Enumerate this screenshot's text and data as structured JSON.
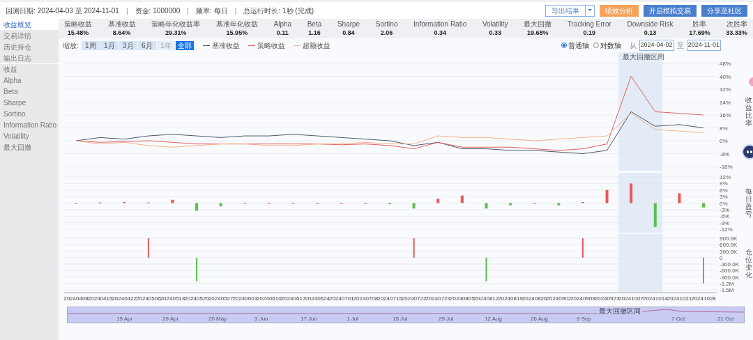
{
  "header": {
    "separator": "|",
    "info": [
      {
        "label": "回测日期:",
        "value": "2024-04-03 至 2024-11-01"
      },
      {
        "label": "资金:",
        "value": "1000000"
      },
      {
        "label": "频率:",
        "value": "每日"
      },
      {
        "label": "总运行时长:",
        "value": "1秒 (完成)"
      }
    ],
    "export_button": "导出结果",
    "buttons": [
      {
        "label": "绩效分析",
        "kind": "orange"
      },
      {
        "label": "开启模拟交易",
        "kind": "blue"
      },
      {
        "label": "分享至社区",
        "kind": "blue"
      }
    ]
  },
  "sidebar": {
    "items": [
      {
        "label": "收益概览",
        "selected": true,
        "kind": "nav"
      },
      {
        "label": "交易详情",
        "selected": false,
        "kind": "nav"
      },
      {
        "label": "历史持仓",
        "selected": false,
        "kind": "nav"
      },
      {
        "label": "输出日志",
        "selected": false,
        "kind": "nav"
      },
      {
        "label": "收益",
        "selected": false,
        "kind": "metric"
      },
      {
        "label": "Alpha",
        "selected": false,
        "kind": "metric"
      },
      {
        "label": "Beta",
        "selected": false,
        "kind": "metric"
      },
      {
        "label": "Sharpe",
        "selected": false,
        "kind": "metric"
      },
      {
        "label": "Sortino",
        "selected": false,
        "kind": "metric"
      },
      {
        "label": "Information Ratio",
        "selected": false,
        "kind": "metric"
      },
      {
        "label": "Volatility",
        "selected": false,
        "kind": "metric"
      },
      {
        "label": "最大回撤",
        "selected": false,
        "kind": "metric"
      }
    ]
  },
  "metrics": [
    {
      "label": "策略收益",
      "value": "15.48%"
    },
    {
      "label": "基准收益",
      "value": "8.64%"
    },
    {
      "label": "策略年化收益率",
      "value": "29.31%"
    },
    {
      "label": "基准年化收益",
      "value": "15.95%"
    },
    {
      "label": "Alpha",
      "value": "0.11"
    },
    {
      "label": "Beta",
      "value": "1.16"
    },
    {
      "label": "Sharpe",
      "value": "0.84"
    },
    {
      "label": "Sortino",
      "value": "2.06"
    },
    {
      "label": "Information Ratio",
      "value": "0.34"
    },
    {
      "label": "Volatility",
      "value": "0.33"
    },
    {
      "label": "最大回撤",
      "value": "19.68%"
    },
    {
      "label": "Tracking Error",
      "value": "0.19"
    },
    {
      "label": "Downside Risk",
      "value": "0.13"
    },
    {
      "label": "胜率",
      "value": "17.69%"
    },
    {
      "label": "次胜率",
      "value": "33.33%"
    }
  ],
  "zoom": {
    "label": "缩放:",
    "ranges": [
      {
        "label": "1周",
        "selected": false,
        "disabled": false
      },
      {
        "label": "1月",
        "selected": false,
        "disabled": false
      },
      {
        "label": "3月",
        "selected": false,
        "disabled": false
      },
      {
        "label": "6月",
        "selected": false,
        "disabled": false
      },
      {
        "label": "1年",
        "selected": false,
        "disabled": true
      },
      {
        "label": "全部",
        "selected": true,
        "disabled": false
      }
    ]
  },
  "axis_mode": [
    {
      "label": "普通轴",
      "selected": true
    },
    {
      "label": "对数轴",
      "selected": false
    }
  ],
  "date_range": {
    "from_label": "从",
    "from": "2024-04-02",
    "to_label": "至",
    "to": "2024-11-01"
  },
  "charts": [
    {
      "axis_name": "收益比率",
      "band_label": "最大回撤区间",
      "chart_data": {
        "type": "line",
        "grid": true,
        "series": [
          {
            "name": "基准收益",
            "color": "#4a5a6a",
            "values": [
              0,
              2,
              1,
              3,
              4,
              3,
              2,
              3,
              3,
              4,
              3,
              2,
              1,
              0,
              -3,
              -1,
              -5,
              -5,
              -6,
              -6,
              -7,
              -8,
              -6,
              18,
              9,
              10,
              8
            ]
          },
          {
            "name": "策略收益",
            "color": "#e06060",
            "values": [
              0,
              -1,
              -0.5,
              0,
              -1,
              -2,
              -2,
              -2,
              -2,
              -2,
              -2,
              -2.5,
              -2,
              -3,
              -5,
              -1,
              -4,
              -4,
              -4,
              -5,
              -6,
              -5,
              -2,
              40,
              18,
              17,
              16
            ]
          },
          {
            "name": "超额收益",
            "color": "#f5b08a",
            "values": [
              0,
              -2,
              -1,
              -3,
              -4,
              -3,
              -2,
              -2,
              -3,
              -3,
              -2,
              -2,
              -1,
              -2,
              -2,
              3,
              2,
              2,
              1,
              0,
              1,
              2,
              3,
              17,
              7,
              6,
              5
            ]
          }
        ],
        "ylim": [
          -16,
          48
        ],
        "yticks": [
          {
            "value": -16,
            "label": "-16%"
          },
          {
            "value": -8,
            "label": "-8%"
          },
          {
            "value": 0,
            "label": "0%"
          },
          {
            "value": 8,
            "label": "8%"
          },
          {
            "value": 16,
            "label": "16%"
          },
          {
            "value": 24,
            "label": "24%"
          },
          {
            "value": 32,
            "label": "32%"
          },
          {
            "value": 40,
            "label": "40%"
          },
          {
            "value": 48,
            "label": "48%"
          }
        ]
      }
    },
    {
      "axis_name": "每日盈亏",
      "chart_data": {
        "type": "bar",
        "grid": true,
        "values": [
          0,
          0.3,
          0.5,
          0.3,
          1.5,
          -3.5,
          -1.5,
          0,
          0,
          0,
          0,
          0,
          0,
          -0.5,
          -2.5,
          2,
          3.5,
          -2.5,
          -1,
          0,
          -1,
          0.5,
          6,
          9,
          -11,
          4.5,
          -2
        ],
        "ylim": [
          -12,
          12
        ],
        "yticks": [
          {
            "value": -12,
            "label": "-12%"
          },
          {
            "value": -9,
            "label": "-9%"
          },
          {
            "value": -6,
            "label": "-6%"
          },
          {
            "value": -3,
            "label": "-3%"
          },
          {
            "value": 0,
            "label": "0%"
          },
          {
            "value": 3,
            "label": "3%"
          },
          {
            "value": 6,
            "label": "6%"
          },
          {
            "value": 9,
            "label": "9%"
          },
          {
            "value": 12,
            "label": "12%"
          }
        ]
      }
    },
    {
      "axis_name": "仓位变化",
      "chart_data": {
        "type": "bar",
        "grid": true,
        "categories": [
          "20240408",
          "20240415",
          "20240422",
          "20240506",
          "20240513",
          "20240520",
          "20240527",
          "20240603",
          "20240610",
          "20240617",
          "20240624",
          "20240701",
          "20240708",
          "20240715",
          "20240722",
          "20240729",
          "20240805",
          "20240812",
          "20240819",
          "20240826",
          "20240902",
          "20240909",
          "20240923",
          "20241007",
          "20241014",
          "20241021",
          "20241028"
        ],
        "values": [
          null,
          null,
          null,
          900000,
          null,
          -1100000,
          null,
          null,
          null,
          null,
          null,
          null,
          null,
          null,
          900000,
          null,
          null,
          -1100000,
          null,
          null,
          null,
          900000,
          null,
          null,
          null,
          null,
          -1200000
        ],
        "ylim": [
          -1500000,
          900000
        ],
        "yticks": [
          {
            "value": -1500000,
            "label": "-1.5M"
          },
          {
            "value": -1200000,
            "label": "-1.2M"
          },
          {
            "value": -900000,
            "label": "-900.0K"
          },
          {
            "value": -600000,
            "label": "-600.0K"
          },
          {
            "value": -300000,
            "label": "-300.0K"
          },
          {
            "value": 0,
            "label": "0"
          },
          {
            "value": 300000,
            "label": "300.0K"
          },
          {
            "value": 600000,
            "label": "600.0K"
          },
          {
            "value": 900000,
            "label": "900.0K"
          }
        ]
      }
    }
  ],
  "slider": {
    "level": 1,
    "labels": [
      "15 Apr",
      "29 Apr",
      "20 May",
      "3 Jun",
      "17 Jun",
      "1 Jul",
      "15 Jul",
      "29 Jul",
      "12 Aug",
      "26 Aug",
      "9 Sep",
      "7 Oct",
      "21 Oct"
    ],
    "band_label": "最大回撤区间"
  }
}
